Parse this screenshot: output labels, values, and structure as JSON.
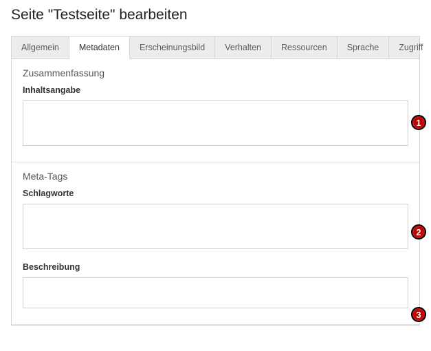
{
  "pageTitle": "Seite \"Testseite\" bearbeiten",
  "tabs": [
    {
      "id": "allgemein",
      "label": "Allgemein",
      "active": false
    },
    {
      "id": "metadaten",
      "label": "Metadaten",
      "active": true
    },
    {
      "id": "erscheinungsbild",
      "label": "Erscheinungsbild",
      "active": false
    },
    {
      "id": "verhalten",
      "label": "Verhalten",
      "active": false
    },
    {
      "id": "ressourcen",
      "label": "Ressourcen",
      "active": false
    },
    {
      "id": "sprache",
      "label": "Sprache",
      "active": false
    },
    {
      "id": "zugriff",
      "label": "Zugriff",
      "active": false
    }
  ],
  "sections": {
    "summary": {
      "title": "Zusammenfassung",
      "fields": {
        "inhaltsangabe": {
          "label": "Inhaltsangabe",
          "value": ""
        }
      }
    },
    "metatags": {
      "title": "Meta-Tags",
      "fields": {
        "schlagworte": {
          "label": "Schlagworte",
          "value": ""
        },
        "beschreibung": {
          "label": "Beschreibung",
          "value": ""
        }
      }
    }
  },
  "annotations": [
    {
      "num": "1"
    },
    {
      "num": "2"
    },
    {
      "num": "3"
    }
  ]
}
